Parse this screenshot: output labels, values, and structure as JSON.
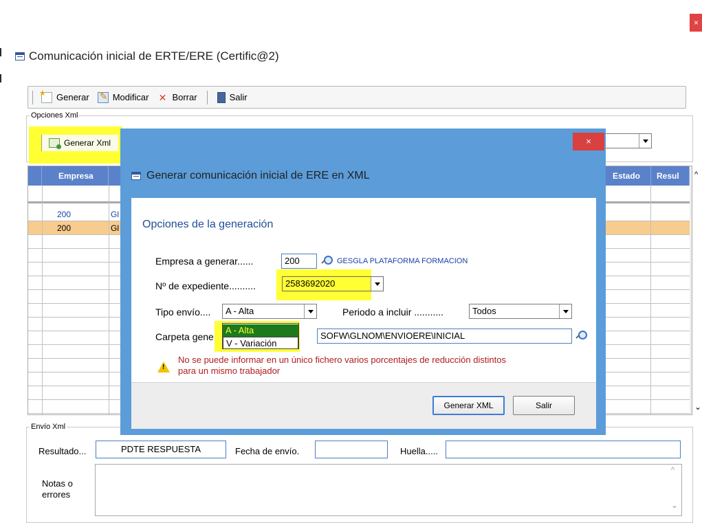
{
  "window": {
    "title": "Comunicación inicial de ERTE/ERE (Certific@2)",
    "close_glyph": "×"
  },
  "toolbar": {
    "generar": "Generar",
    "modificar": "Modificar",
    "borrar": "Borrar",
    "salir": "Salir"
  },
  "opciones_xml": {
    "legend": "Opciones Xml",
    "generar_xml_button": "Generar Xml"
  },
  "grid": {
    "headers": {
      "empresa": "Empresa",
      "estado": "Estado",
      "resul": "Resul"
    },
    "rows": [
      {
        "empresa": "200",
        "nombre": "Gl",
        "selected": false
      },
      {
        "empresa": "200",
        "nombre": "Gl",
        "selected": true
      }
    ],
    "selected_row_color": "#f8cc8e",
    "header_color": "#5a81c9"
  },
  "envio_xml": {
    "legend": "Envío Xml",
    "resultado_label": "Resultado...",
    "resultado_value": "PDTE RESPUESTA",
    "fecha_label": "Fecha de envío.",
    "fecha_value": "",
    "huella_label": "Huella.....",
    "huella_value": "",
    "notas_label_1": "Notas o",
    "notas_label_2": "errores",
    "notas_value": ""
  },
  "dialog": {
    "title": "Generar comunicación inicial de ERE en XML",
    "close_glyph": "×",
    "section": "Opciones de la generación",
    "empresa_label": "Empresa a generar......",
    "empresa_value": "200",
    "empresa_name": "GESGLA PLATAFORMA FORMACION",
    "expediente_label": "Nº de expediente..........",
    "expediente_value": "2583692020",
    "tipo_label": "Tipo envío....",
    "tipo_value": "A - Alta",
    "tipo_options": [
      "A - Alta",
      "V - Variación"
    ],
    "periodo_label": "Periodo a incluir ...........",
    "periodo_value": "Todos",
    "carpeta_label": "Carpeta gene",
    "carpeta_value": "SOFW\\GLNOM\\ENVIOERE\\INICIAL",
    "warning_line1": "No se puede informar en un único fichero varios porcentajes de reducción distintos",
    "warning_line2": "para un mismo trabajador",
    "generar_xml": "Generar XML",
    "salir": "Salir",
    "accent_color": "#5b9cd9",
    "highlight_color": "#ffff33"
  }
}
